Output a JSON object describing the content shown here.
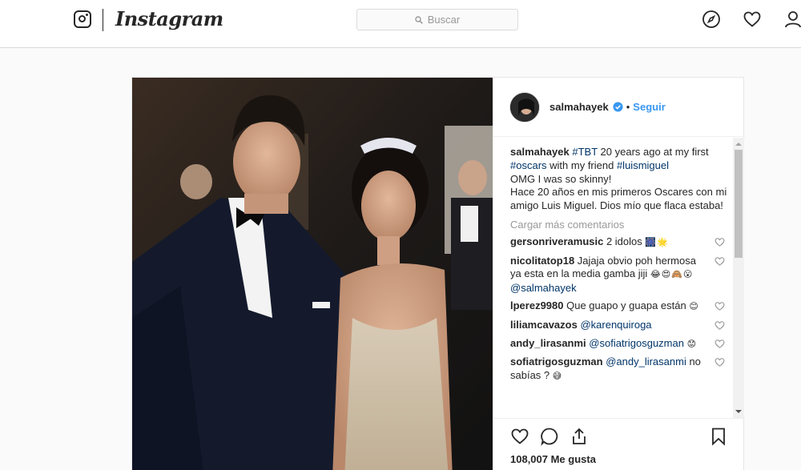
{
  "header": {
    "brand": "Instagram",
    "search_placeholder": "Buscar",
    "icons": [
      "instagram-glyph-icon",
      "explore-compass-icon",
      "activity-heart-icon",
      "profile-icon"
    ]
  },
  "post": {
    "author": "salmahayek",
    "verified": true,
    "follow_label": "Seguir",
    "caption": {
      "user": "salmahayek",
      "hashtag_tbt": "#TBT",
      "text_1": " 20 years ago at my first ",
      "hashtag_oscars": "#oscars",
      "text_2": " with my friend ",
      "hashtag_luismiguel": "#luismiguel",
      "line_3": "OMG I was so skinny!",
      "line_4": "Hace 20 años en mis primeros Oscares con mi amigo Luis Miguel. Dios mío que flaca estaba!"
    },
    "load_more": "Cargar más comentarios",
    "comments": [
      {
        "user": "gersonriveramusic",
        "text": " 2 idolos ",
        "emoji": "🎆🌟"
      },
      {
        "user": "nicolitatop18",
        "text": " Jajaja obvio poh hermosa ya esta en la media gamba jiji ",
        "emoji": "😂😍🙈😮",
        "mention": "@salmahayek"
      },
      {
        "user": "lperez9980",
        "text": " Que guapo y guapa están ",
        "emoji": "😊"
      },
      {
        "user": "liliamcavazos",
        "mention": "@karenquiroga"
      },
      {
        "user": "andy_lirasanmi",
        "mention": "@sofiatrigosguzman",
        "emoji": "😟"
      },
      {
        "user": "sofiatrigosguzman",
        "mention": "@andy_lirasanmi",
        "text": " no sabías ? ",
        "emoji": "😅"
      }
    ],
    "likes": "108,007 Me gusta",
    "colors": {
      "link": "#003569",
      "follow": "#3897f0",
      "verified": "#3897f0"
    }
  }
}
